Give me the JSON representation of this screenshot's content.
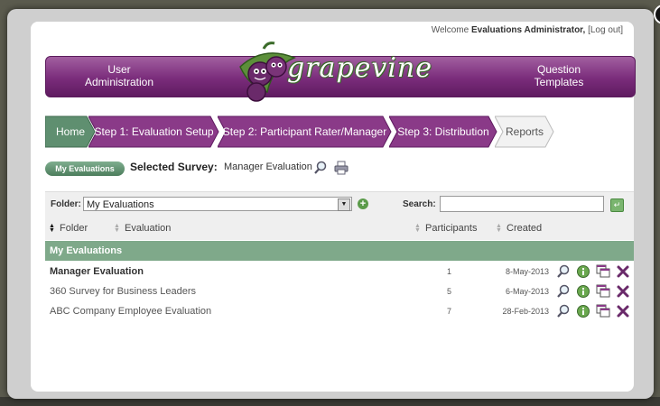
{
  "header": {
    "welcome_prefix": "Welcome",
    "user_name": "Evaluations Administrator,",
    "logout": "[Log out]",
    "nav_left_line1": "User",
    "nav_left_line2": "Administration",
    "nav_right_line1": "Question",
    "nav_right_line2": "Templates",
    "logo_text": "grapevine"
  },
  "breadcrumbs": [
    {
      "label": "Home"
    },
    {
      "label": "Step 1: Evaluation Setup"
    },
    {
      "label": "Step 2: Participant Rater/Manager"
    },
    {
      "label": "Step 3: Distribution"
    },
    {
      "label": "Reports"
    }
  ],
  "selection": {
    "pill_label": "My Evaluations",
    "label": "Selected Survey:",
    "value": "Manager Evaluation"
  },
  "toolbar": {
    "folder_label": "Folder:",
    "folder_value": "My Evaluations",
    "search_label": "Search:",
    "search_value": ""
  },
  "table": {
    "columns": [
      "Folder",
      "Evaluation",
      "Participants",
      "Created"
    ],
    "group_label": "My Evaluations",
    "rows": [
      {
        "name": "Manager Evaluation",
        "participants": "1",
        "created": "8-May-2013"
      },
      {
        "name": "360 Survey for Business Leaders",
        "participants": "5",
        "created": "6-May-2013"
      },
      {
        "name": "ABC Company Employee Evaluation",
        "participants": "7",
        "created": "28-Feb-2013"
      }
    ]
  },
  "colors": {
    "banner_purple": "#7a2c7b",
    "step_purple": "#8a3a88",
    "home_green": "#5f8f70",
    "group_green": "#7fa98a"
  }
}
